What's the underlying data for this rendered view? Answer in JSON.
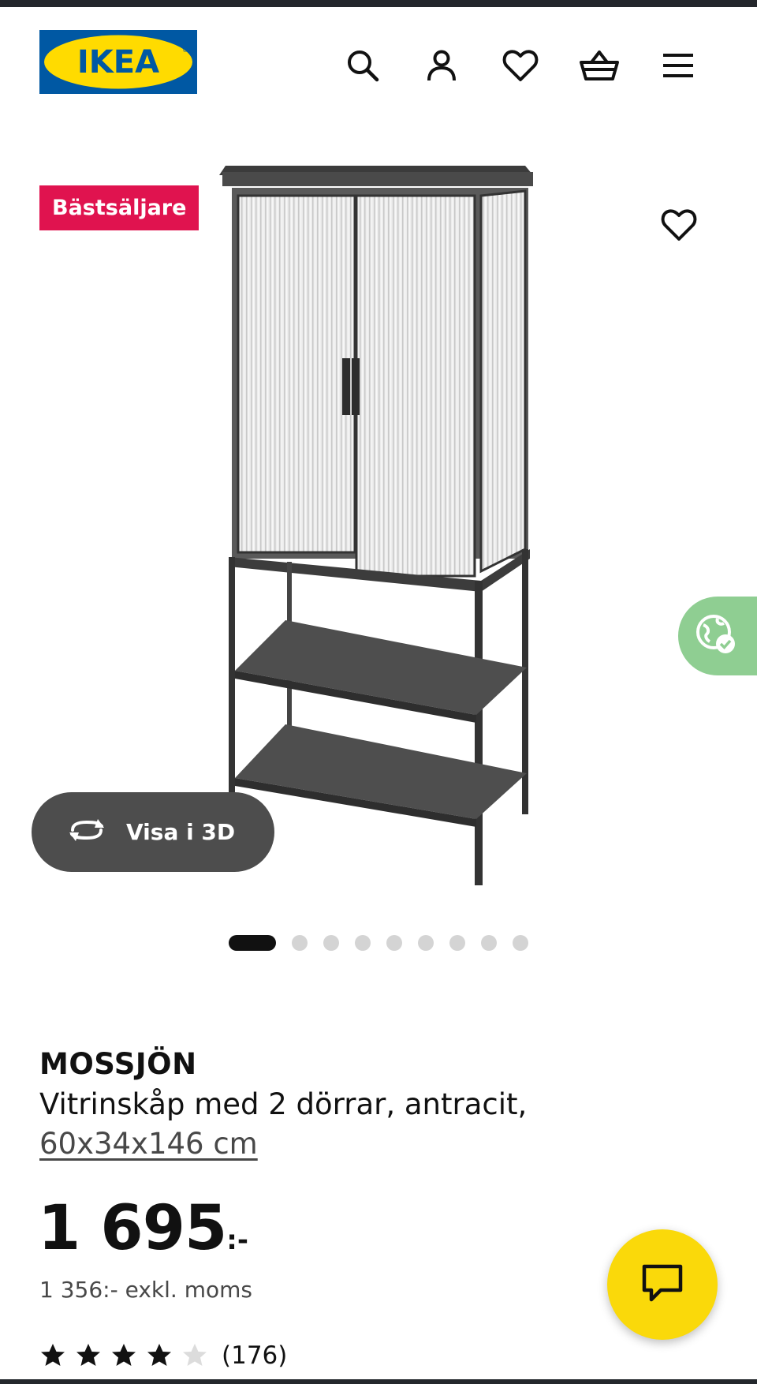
{
  "header": {
    "logo_text": "IKEA",
    "icons": [
      "search-icon",
      "user-icon",
      "heart-icon",
      "basket-icon",
      "menu-icon"
    ]
  },
  "gallery": {
    "badge": "Bästsäljare",
    "view_3d_label": "Visa i 3D",
    "image_count": 9,
    "active_index": 0
  },
  "product": {
    "brand": "MOSSJÖN",
    "description": "Vitrinskåp med 2 dörrar, antracit,",
    "dimensions": "60x34x146 cm",
    "price_main": "1 695",
    "price_suffix": ":-",
    "price_excl_vat": "1 356:- exkl. moms",
    "rating": 4,
    "rating_max": 5,
    "review_count": "(176)"
  },
  "colors": {
    "badge": "#e0134f",
    "logo_blue": "#0058a3",
    "logo_yellow": "#ffdb00",
    "chat": "#fad90a",
    "eco": "#8fce92"
  }
}
